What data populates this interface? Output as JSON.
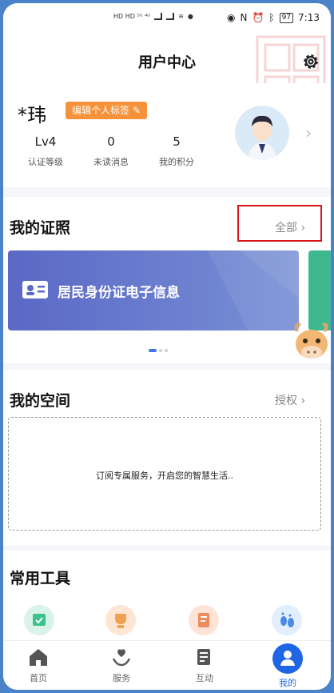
{
  "statusbar": {
    "left_icons": "HD HD ⁵ᴳ ⁴ᴳ",
    "battery": "97",
    "time": "7:13"
  },
  "header": {
    "title": "用户中心"
  },
  "profile": {
    "name": "*玮",
    "tag_label": "编辑个人标签",
    "stats": [
      {
        "value": "Lv4",
        "label": "认证等级"
      },
      {
        "value": "0",
        "label": "未读消息"
      },
      {
        "value": "5",
        "label": "我的积分"
      }
    ]
  },
  "licenses": {
    "title": "我的证照",
    "link": "全部",
    "card_label": "居民身份证电子信息"
  },
  "space": {
    "title": "我的空间",
    "link": "授权",
    "empty_text": "订阅专属服务，开启您的智慧生活.."
  },
  "tools": {
    "title": "常用工具"
  },
  "tabbar": {
    "tabs": [
      {
        "label": "首页"
      },
      {
        "label": "服务"
      },
      {
        "label": "互动"
      },
      {
        "label": "我的"
      }
    ]
  },
  "colors": {
    "accent": "#1e66e6",
    "tag": "#f6923a",
    "card": "#5b68c6",
    "highlight": "#d8141d"
  }
}
